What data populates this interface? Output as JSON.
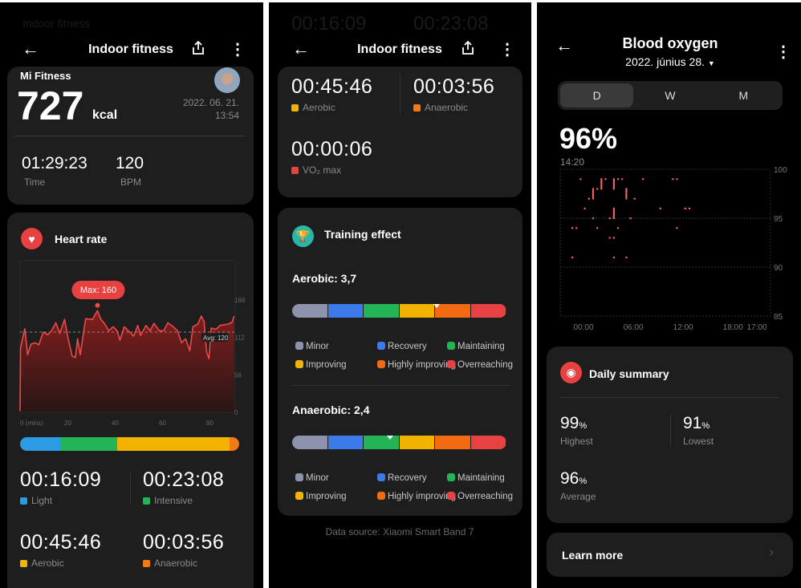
{
  "colors": {
    "light": "#2c9be6",
    "intensive": "#22b455",
    "aerobic": "#f2b200",
    "anaerobic": "#f47a14",
    "vo2": "#e84142",
    "red": "#e84142",
    "teal": "#2ab5a8",
    "effect": [
      "#8e93ad",
      "#3b7ae8",
      "#22b455",
      "#f2b200",
      "#f26a12",
      "#e84142"
    ]
  },
  "left": {
    "ghost_text": "Indoor fitness",
    "header": {
      "title": "Indoor fitness",
      "back_icon": "arrow-left-icon",
      "share_icon": "share-icon",
      "more_icon": "more-vertical-icon"
    },
    "summary": {
      "source": "Mi Fitness",
      "calories": "727",
      "calories_unit": "kcal",
      "date": "2022. 06. 21.",
      "time": "13:54",
      "duration": "01:29:23",
      "duration_label": "Time",
      "bpm": "120",
      "bpm_label": "BPM"
    },
    "heart": {
      "title": "Heart rate",
      "icon": "heart-icon",
      "max_label": "Max: 160",
      "avg_label": "Avg: 120",
      "zones": [
        {
          "value": "00:16:09",
          "label": "Light",
          "key": "light",
          "seconds": 969
        },
        {
          "value": "00:23:08",
          "label": "Intensive",
          "key": "intensive",
          "seconds": 1388
        },
        {
          "value": "00:45:46",
          "label": "Aerobic",
          "key": "aerobic",
          "seconds": 2746
        },
        {
          "value": "00:03:56",
          "label": "Anaerobic",
          "key": "anaerobic",
          "seconds": 236
        }
      ]
    }
  },
  "middle": {
    "ghost_text": [
      "00:16:09",
      "00:23:08"
    ],
    "header": {
      "title": "Indoor fitness"
    },
    "zones": [
      {
        "value": "00:45:46",
        "label": "Aerobic",
        "key": "aerobic"
      },
      {
        "value": "00:03:56",
        "label": "Anaerobic",
        "key": "anaerobic"
      },
      {
        "value": "00:00:06",
        "label": "VO₂ max",
        "key": "vo2"
      }
    ],
    "training": {
      "title": "Training effect",
      "icon": "trophy-icon",
      "aerobic": {
        "label": "Aerobic: 3,7",
        "value": 3.7
      },
      "anaerobic": {
        "label": "Anaerobic: 2,4",
        "value": 2.4
      },
      "legend": [
        "Minor",
        "Recovery",
        "Maintaining",
        "Improving",
        "Highly improving",
        "Overreaching"
      ]
    },
    "data_source": "Data source: Xiaomi Smart Band 7"
  },
  "right": {
    "header": {
      "title": "Blood oxygen",
      "date": "2022. június 28."
    },
    "tabs": [
      {
        "label": "D",
        "selected": true
      },
      {
        "label": "W",
        "selected": false
      },
      {
        "label": "M",
        "selected": false
      }
    ],
    "current": "96%",
    "current_time": "14:20",
    "summary": {
      "title": "Daily summary",
      "icon": "eye-icon",
      "highest": {
        "value": "99",
        "unit": "%",
        "label": "Highest"
      },
      "lowest": {
        "value": "91",
        "unit": "%",
        "label": "Lowest"
      },
      "average": {
        "value": "96",
        "unit": "%",
        "label": "Average"
      }
    },
    "learn_more": "Learn more"
  },
  "chart_data": [
    {
      "type": "area",
      "x_unit": "(mins)",
      "xticks": [
        "0 (mins)",
        "20",
        "40",
        "60",
        "80"
      ],
      "xtick_values": [
        0,
        20,
        40,
        60,
        80
      ],
      "yticks": [
        "168",
        "112",
        "56",
        "0"
      ],
      "ytick_values": [
        168,
        112,
        56,
        0
      ],
      "xlim": [
        0,
        90.5
      ],
      "ylim": [
        0,
        168
      ],
      "max": 160,
      "avg": 120,
      "x": [
        0,
        0.2,
        2,
        3.2,
        4.6,
        6.4,
        7.9,
        9.8,
        11.6,
        13.3,
        15.1,
        16.8,
        18.8,
        20.2,
        22,
        23.4,
        24.3,
        25.4,
        27.7,
        30.6,
        32.7,
        34,
        35.8,
        37.5,
        39.3,
        41,
        42.2,
        44,
        45.7,
        48,
        49.7,
        50.9,
        53.2,
        54.9,
        56.6,
        58.8,
        60.7,
        62.4,
        64.7,
        66.5,
        68.2,
        69.9,
        71.7,
        73,
        75.1,
        76.5,
        77.7,
        78.8,
        79.8,
        80.7,
        82.7,
        84.4,
        87.9,
        89.6,
        90.4
      ],
      "y": [
        2,
        96,
        125,
        86,
        102,
        104,
        101,
        120,
        116,
        122,
        134,
        118,
        139,
        112,
        84,
        82,
        110,
        86,
        140,
        139,
        152,
        140,
        132,
        122,
        128,
        122,
        108,
        128,
        122,
        114,
        130,
        115,
        130,
        122,
        133,
        122,
        122,
        134,
        128,
        122,
        104,
        110,
        92,
        128,
        132,
        144,
        136,
        90,
        80,
        126,
        124,
        130,
        132,
        135,
        144
      ]
    },
    {
      "type": "scatter",
      "xticks": [
        "00:00",
        "06:00",
        "12:00",
        "18:00"
      ],
      "xtick_values": [
        0,
        6,
        12,
        18
      ],
      "end_label": "17:00",
      "yticks": [
        "100",
        "95",
        "90",
        "85"
      ],
      "ytick_values": [
        100,
        95,
        90,
        85
      ],
      "xlim": [
        0,
        24
      ],
      "ylim": [
        85,
        100
      ],
      "points": [
        [
          0,
          94,
          94
        ],
        [
          0.5,
          94,
          94
        ],
        [
          0,
          91,
          91
        ],
        [
          1,
          99,
          99
        ],
        [
          1.5,
          96,
          96
        ],
        [
          2,
          97,
          97
        ],
        [
          2.5,
          97,
          98
        ],
        [
          2.5,
          95,
          95
        ],
        [
          3,
          98,
          98
        ],
        [
          3,
          94,
          94
        ],
        [
          3.5,
          98,
          99
        ],
        [
          4,
          99,
          99
        ],
        [
          4.5,
          95,
          95
        ],
        [
          4.5,
          93,
          93
        ],
        [
          5,
          98,
          99
        ],
        [
          5,
          95,
          96
        ],
        [
          5,
          93,
          93
        ],
        [
          5,
          91,
          91
        ],
        [
          5.5,
          99,
          99
        ],
        [
          5.5,
          94,
          94
        ],
        [
          6,
          99,
          99
        ],
        [
          6.5,
          97,
          98
        ],
        [
          6.5,
          91,
          91
        ],
        [
          7,
          95,
          95
        ],
        [
          7.5,
          97,
          97
        ],
        [
          8.5,
          99,
          99
        ],
        [
          10.6,
          96,
          96
        ],
        [
          12.1,
          99,
          99
        ],
        [
          12.6,
          99,
          99
        ],
        [
          12.6,
          94,
          94
        ],
        [
          13.6,
          96,
          96
        ],
        [
          14.1,
          96,
          96
        ]
      ]
    }
  ]
}
